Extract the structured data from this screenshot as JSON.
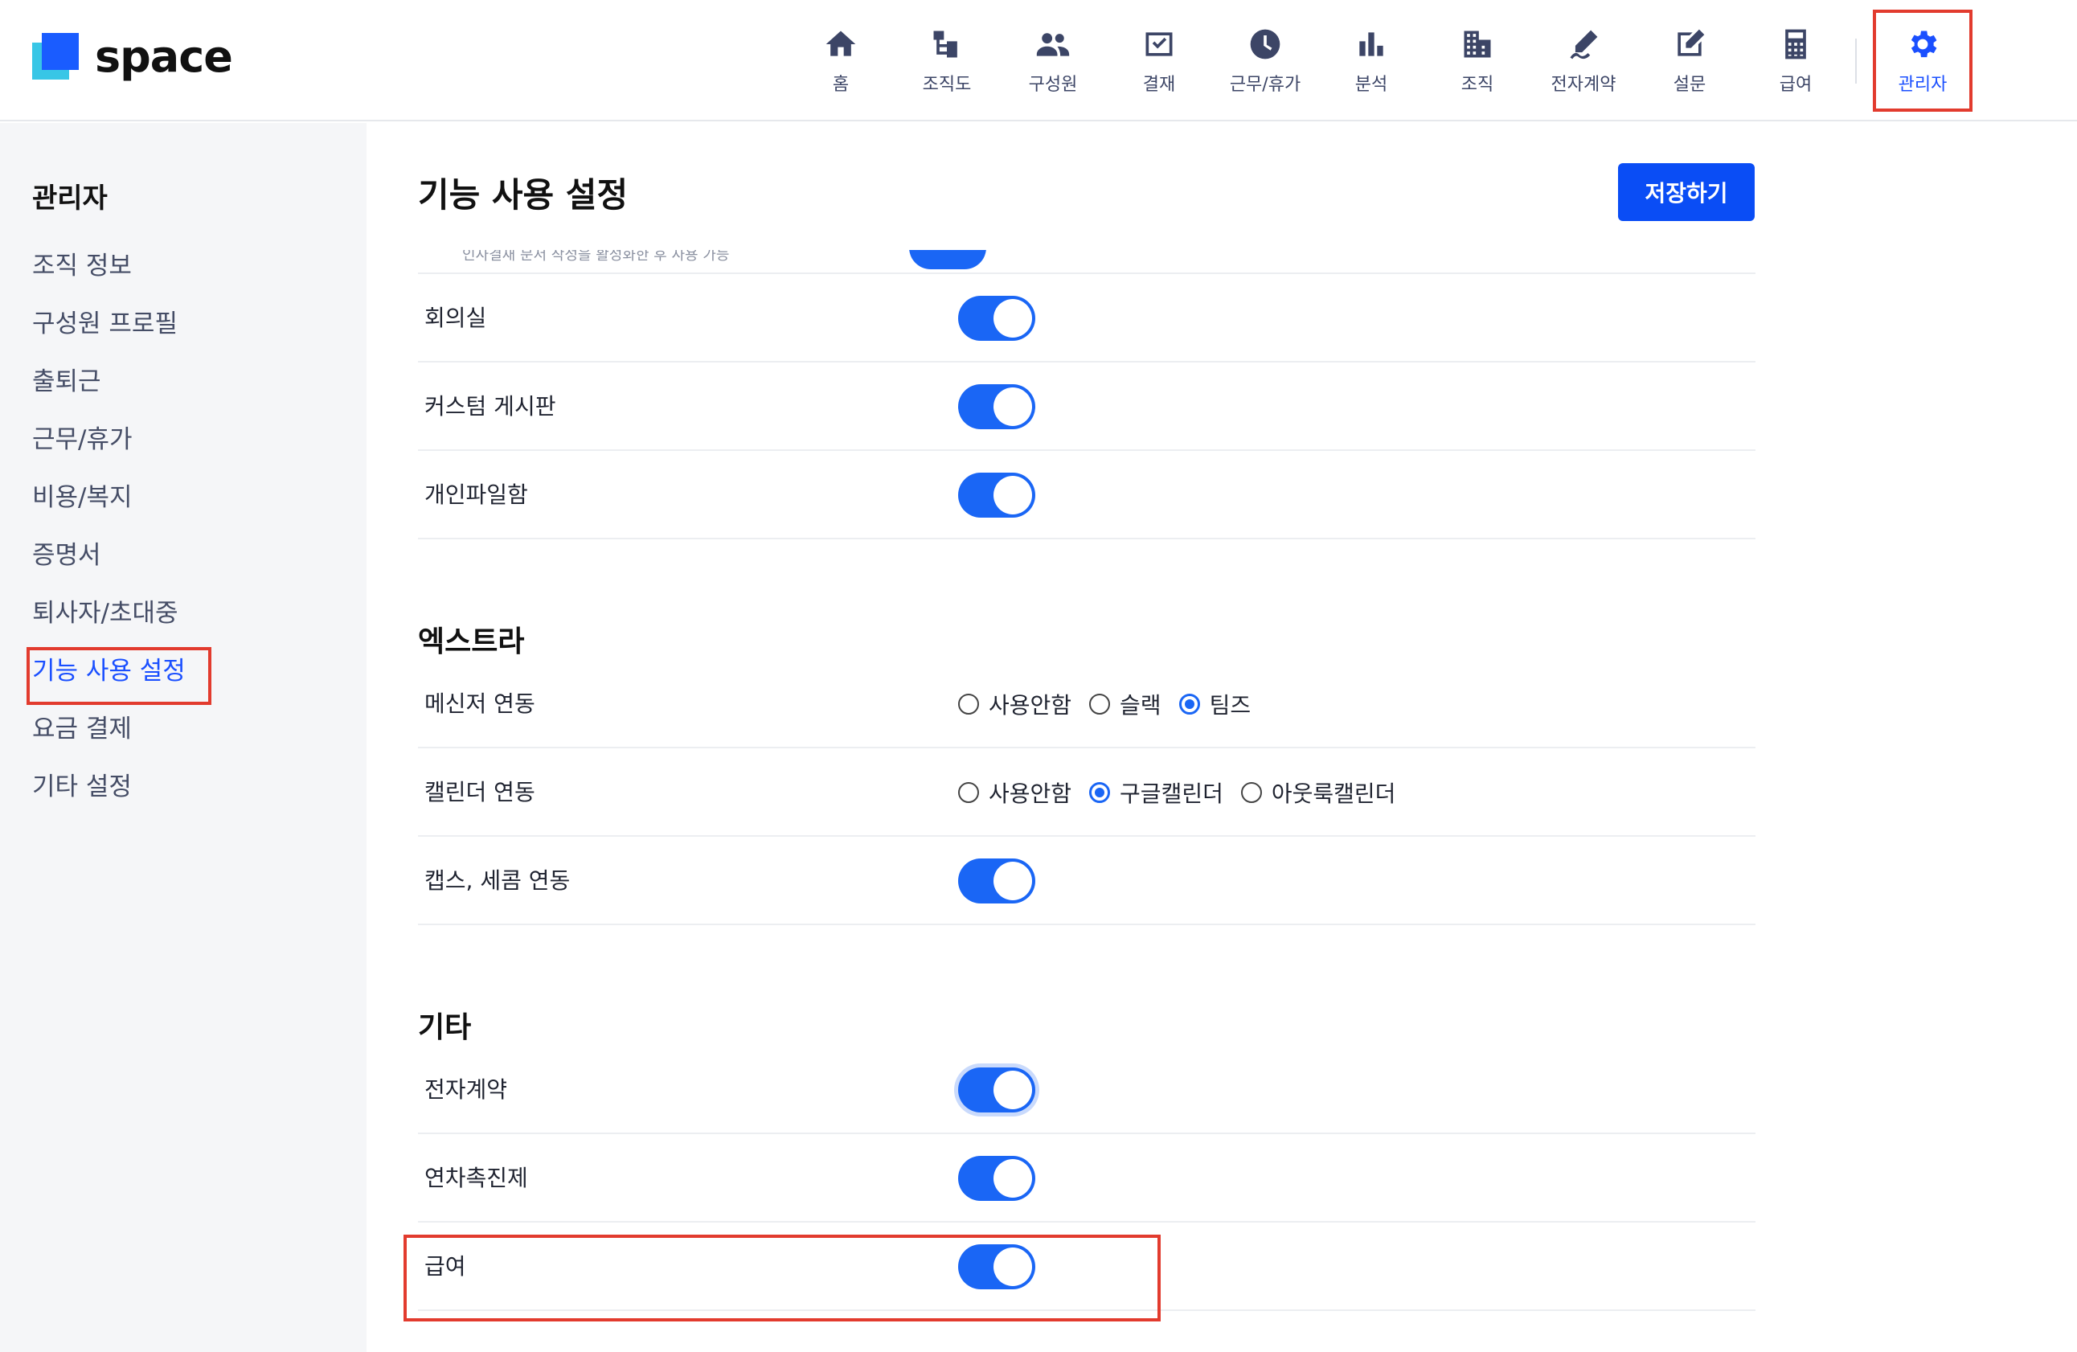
{
  "header": {
    "logo_text": "space",
    "nav": [
      {
        "label": "홈",
        "icon": "home-icon"
      },
      {
        "label": "조직도",
        "icon": "org-chart-icon"
      },
      {
        "label": "구성원",
        "icon": "people-icon"
      },
      {
        "label": "결재",
        "icon": "approval-icon"
      },
      {
        "label": "근무/휴가",
        "icon": "clock-icon"
      },
      {
        "label": "분석",
        "icon": "bar-chart-icon"
      },
      {
        "label": "조직",
        "icon": "building-icon"
      },
      {
        "label": "전자계약",
        "icon": "signature-icon"
      },
      {
        "label": "설문",
        "icon": "survey-icon"
      },
      {
        "label": "급여",
        "icon": "calculator-icon"
      },
      {
        "label": "관리자",
        "icon": "gear-icon"
      }
    ]
  },
  "sidebar": {
    "title": "관리자",
    "items": [
      {
        "label": "조직 정보"
      },
      {
        "label": "구성원 프로필"
      },
      {
        "label": "출퇴근"
      },
      {
        "label": "근무/휴가"
      },
      {
        "label": "비용/복지"
      },
      {
        "label": "증명서"
      },
      {
        "label": "퇴사자/초대중"
      },
      {
        "label": "기능 사용 설정"
      },
      {
        "label": "요금 결제"
      },
      {
        "label": "기타 설정"
      }
    ]
  },
  "main": {
    "title": "기능 사용 설정",
    "save_label": "저장하기",
    "cut_off_text": "인사결재 문서 작성을 활성화한 후 사용 가능",
    "rows_top": [
      {
        "label": "회의실",
        "enabled": true
      },
      {
        "label": "커스텀 게시판",
        "enabled": true
      },
      {
        "label": "개인파일함",
        "enabled": true
      }
    ],
    "extra": {
      "title": "엑스트라",
      "messenger": {
        "label": "메신저 연동",
        "options": [
          "사용안함",
          "슬랙",
          "팀즈"
        ],
        "selected": "팀즈"
      },
      "calendar": {
        "label": "캘린더 연동",
        "options": [
          "사용안함",
          "구글캘린더",
          "아웃룩캘린더"
        ],
        "selected": "구글캘린더"
      },
      "caps": {
        "label": "캡스, 세콤 연동",
        "enabled": true
      }
    },
    "etc": {
      "title": "기타",
      "rows": [
        {
          "label": "전자계약",
          "enabled": true
        },
        {
          "label": "연차촉진제",
          "enabled": true
        },
        {
          "label": "급여",
          "enabled": true
        }
      ]
    }
  },
  "colors": {
    "accent": "#1a66f5",
    "primary_button": "#0a4df5",
    "highlight": "#e23b2e"
  }
}
